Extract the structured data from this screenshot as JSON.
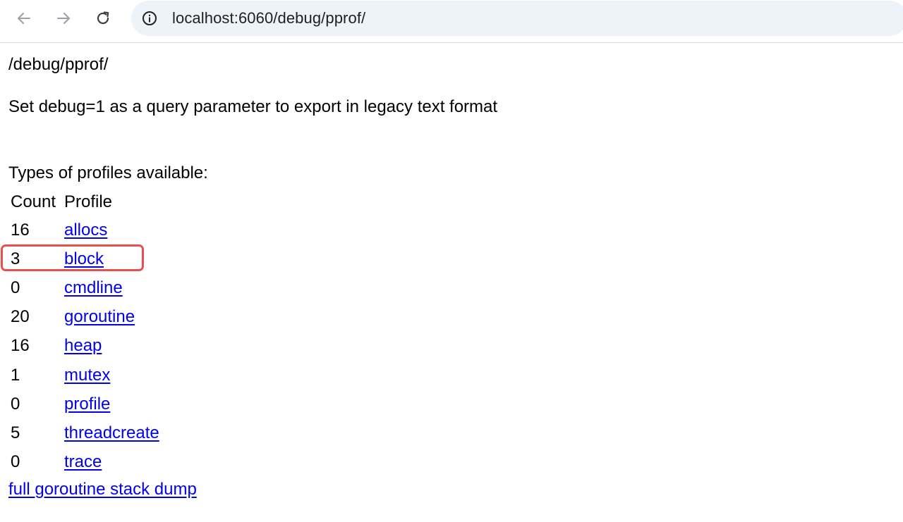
{
  "browser": {
    "url": "localhost:6060/debug/pprof/",
    "icons": {
      "back": "arrow-left-icon",
      "forward": "arrow-right-icon",
      "reload": "reload-icon",
      "site_info": "info-circle-icon"
    }
  },
  "page": {
    "path": "/debug/pprof/",
    "hint": "Set debug=1 as a query parameter to export in legacy text format",
    "types_heading": "Types of profiles available:",
    "table": {
      "headers": [
        "Count",
        "Profile"
      ],
      "rows": [
        {
          "count": "16",
          "profile": "allocs"
        },
        {
          "count": "3",
          "profile": "block"
        },
        {
          "count": "0",
          "profile": "cmdline"
        },
        {
          "count": "20",
          "profile": "goroutine"
        },
        {
          "count": "16",
          "profile": "heap"
        },
        {
          "count": "1",
          "profile": "mutex"
        },
        {
          "count": "0",
          "profile": "profile"
        },
        {
          "count": "5",
          "profile": "threadcreate"
        },
        {
          "count": "0",
          "profile": "trace"
        }
      ]
    },
    "full_dump_link": "full goroutine stack dump"
  },
  "colors": {
    "link": "#0000ee",
    "highlight": "#e8514a",
    "omnibox_bg": "#eef2f9"
  }
}
